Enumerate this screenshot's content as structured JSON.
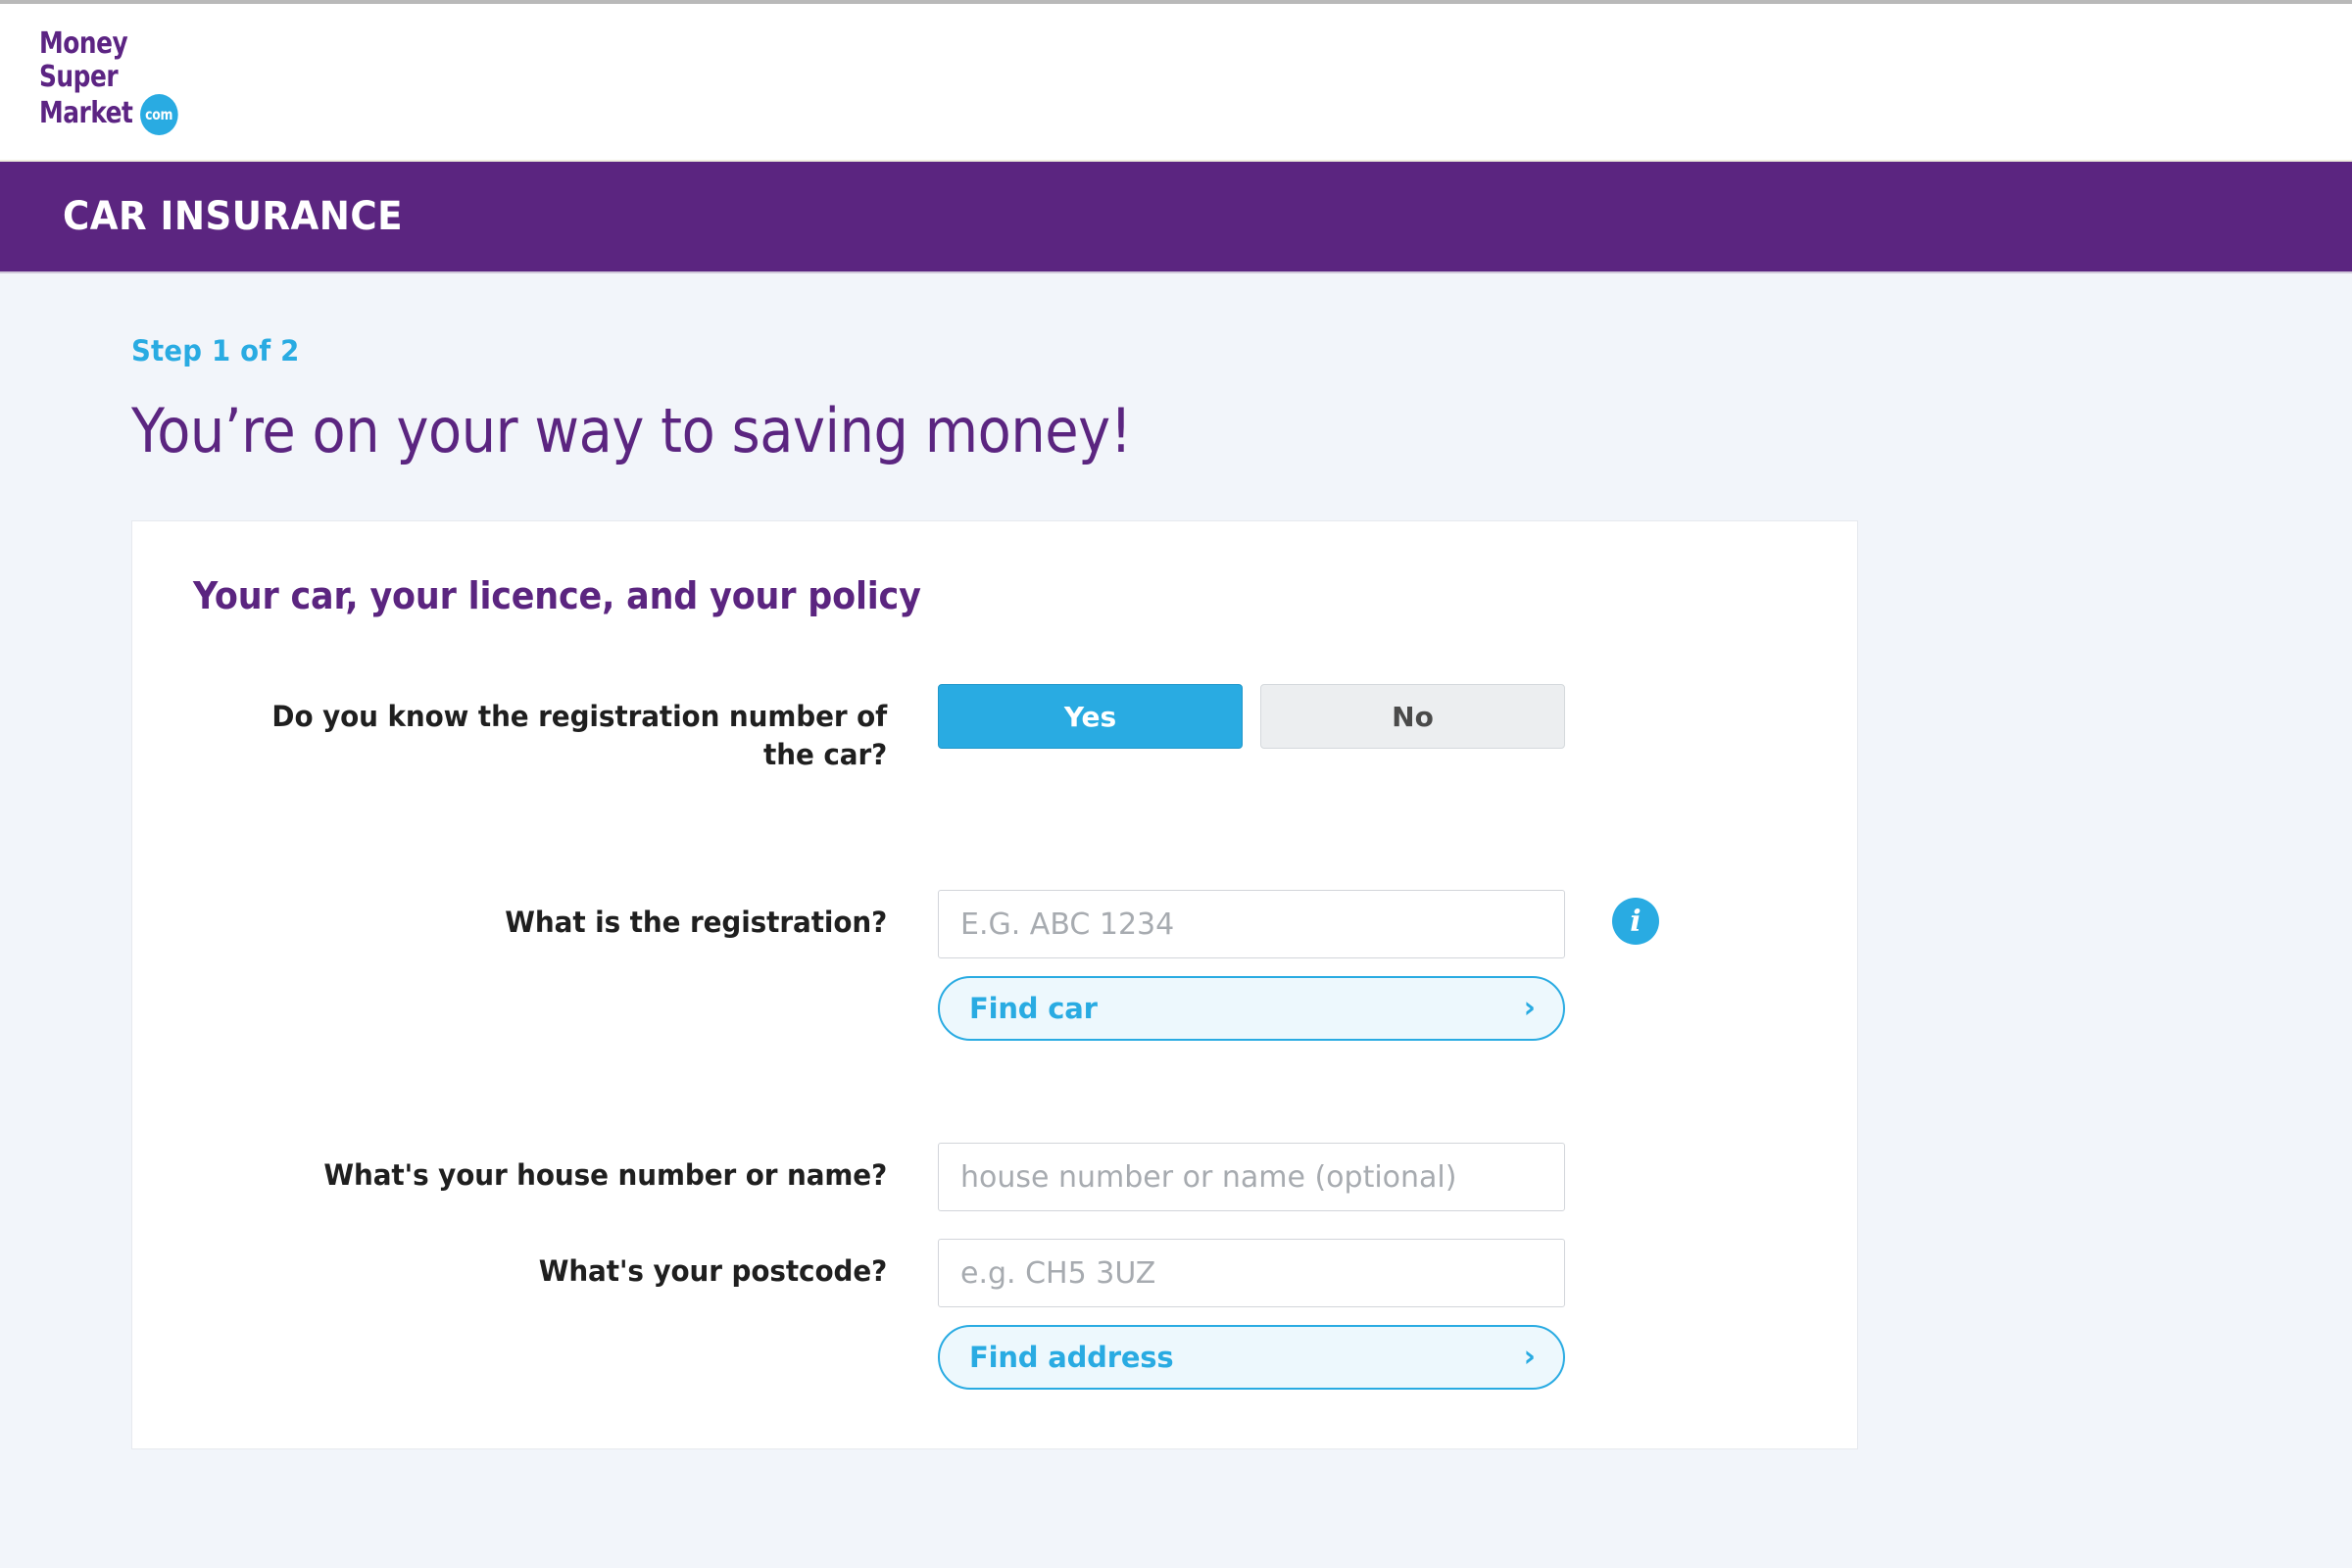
{
  "header": {
    "logo": {
      "line1": "Money",
      "line2": "Super",
      "line3": "Market",
      "badge": "com"
    },
    "product_band_title": "CAR INSURANCE",
    "brand_purple": "#5b2580",
    "brand_blue": "#29abe2"
  },
  "page": {
    "step_label": "Step 1 of 2",
    "title": "You’re on your way to saving money!"
  },
  "card": {
    "heading": "Your car, your licence, and your policy",
    "registration_known": {
      "label": "Do you know the registration number of the car?",
      "options": [
        {
          "label": "Yes",
          "selected": true
        },
        {
          "label": "No",
          "selected": false
        }
      ]
    },
    "registration": {
      "label": "What is the registration?",
      "value": "",
      "placeholder": "E.G. ABC 1234",
      "info_icon": "info-icon",
      "action_label": "Find car",
      "action_chevron": "›"
    },
    "house": {
      "label": "What's your house number or name?",
      "value": "",
      "placeholder": "house number or name (optional)"
    },
    "postcode": {
      "label": "What's your postcode?",
      "value": "",
      "placeholder": "e.g. CH5 3UZ",
      "action_label": "Find address",
      "action_chevron": "›"
    }
  }
}
